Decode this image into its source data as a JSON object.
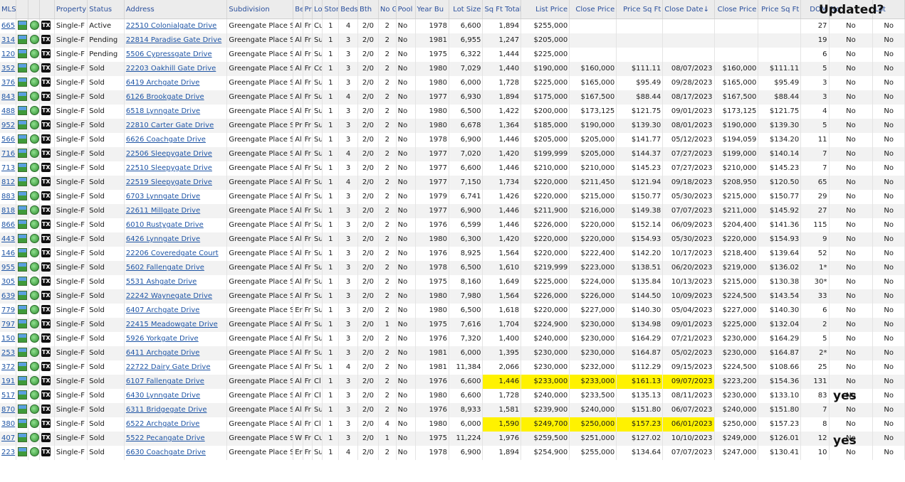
{
  "annotations": {
    "updated_label": "Updated?",
    "yes_label": "yes"
  },
  "columns": [
    "MLS",
    "Property",
    "Status",
    "Address",
    "Subdivision",
    "Be",
    "Pr",
    "Lo",
    "Stori",
    "Beds",
    "Bth",
    "No G",
    "Pool",
    "Year Bu",
    "Lot Size",
    "Sq Ft Total",
    "List Price",
    "Close Price",
    "Price Sq Ft",
    "Close Date",
    "Close Price",
    "Price Sq Ft",
    "DOM",
    "No",
    "Lot"
  ],
  "sort_arrow": "↓",
  "icons": [
    "photo-icon",
    "globe-icon",
    "tx-badge-icon"
  ],
  "tx_label": "TX",
  "rows": [
    {
      "mls": "665",
      "prop": "Single-F",
      "status": "Active",
      "addr": "22510 Colonialgate Drive",
      "subd": "Greengate Place S",
      "be": "Al",
      "pr": "Fr",
      "lo": "Cu",
      "st": "1",
      "beds": "4",
      "bth": "2/0",
      "gar": "2",
      "pool": "No",
      "yr": "1978",
      "lot": "6,600",
      "sqft": "1,894",
      "lp": "$255,000",
      "cp": "",
      "psf": "",
      "cd": "",
      "cp2": "",
      "psf2": "",
      "dom": "27",
      "n1": "No",
      "n2": "No"
    },
    {
      "mls": "314",
      "prop": "Single-F",
      "status": "Pending",
      "addr": "22814 Paradise Gate Drive",
      "subd": "Greengate Place S",
      "be": "Al",
      "pr": "Fr",
      "lo": "Su",
      "st": "1",
      "beds": "3",
      "bth": "2/0",
      "gar": "2",
      "pool": "No",
      "yr": "1981",
      "lot": "6,955",
      "sqft": "1,247",
      "lp": "$205,000",
      "cp": "",
      "psf": "",
      "cd": "",
      "cp2": "",
      "psf2": "",
      "dom": "19",
      "n1": "No",
      "n2": "No"
    },
    {
      "mls": "120",
      "prop": "Single-F",
      "status": "Pending",
      "addr": "5506 Cypressgate Drive",
      "subd": "Greengate Place S",
      "be": "Al",
      "pr": "Fr",
      "lo": "Su",
      "st": "1",
      "beds": "3",
      "bth": "2/0",
      "gar": "2",
      "pool": "No",
      "yr": "1975",
      "lot": "6,322",
      "sqft": "1,444",
      "lp": "$225,000",
      "cp": "",
      "psf": "",
      "cd": "",
      "cp2": "",
      "psf2": "",
      "dom": "6",
      "n1": "No",
      "n2": "No"
    },
    {
      "mls": "352",
      "prop": "Single-F",
      "status": "Sold",
      "addr": "22203 Oakhill Gate Drive",
      "subd": "Greengate Place S",
      "be": "Al",
      "pr": "Fr",
      "lo": "Co",
      "st": "1",
      "beds": "3",
      "bth": "2/0",
      "gar": "2",
      "pool": "No",
      "yr": "1980",
      "lot": "7,029",
      "sqft": "1,440",
      "lp": "$190,000",
      "cp": "$160,000",
      "psf": "$111.11",
      "cd": "08/07/2023",
      "cp2": "$160,000",
      "psf2": "$111.11",
      "dom": "5",
      "n1": "No",
      "n2": "No"
    },
    {
      "mls": "376",
      "prop": "Single-F",
      "status": "Sold",
      "addr": "6419 Archgate Drive",
      "subd": "Greengate Place S",
      "be": "Al",
      "pr": "Fr",
      "lo": "Su",
      "st": "1",
      "beds": "3",
      "bth": "2/0",
      "gar": "2",
      "pool": "No",
      "yr": "1980",
      "lot": "6,000",
      "sqft": "1,728",
      "lp": "$225,000",
      "cp": "$165,000",
      "psf": "$95.49",
      "cd": "09/28/2023",
      "cp2": "$165,000",
      "psf2": "$95.49",
      "dom": "3",
      "n1": "No",
      "n2": "No"
    },
    {
      "mls": "843",
      "prop": "Single-F",
      "status": "Sold",
      "addr": "6126 Brookgate Drive",
      "subd": "Greengate Place S",
      "be": "Al",
      "pr": "Fr",
      "lo": "Su",
      "st": "1",
      "beds": "4",
      "bth": "2/0",
      "gar": "2",
      "pool": "No",
      "yr": "1977",
      "lot": "6,930",
      "sqft": "1,894",
      "lp": "$175,000",
      "cp": "$167,500",
      "psf": "$88.44",
      "cd": "08/17/2023",
      "cp2": "$167,500",
      "psf2": "$88.44",
      "dom": "3",
      "n1": "No",
      "n2": "No"
    },
    {
      "mls": "488",
      "prop": "Single-F",
      "status": "Sold",
      "addr": "6518 Lynngate Drive",
      "subd": "Greengate Place S",
      "be": "Al",
      "pr": "Fr",
      "lo": "Su",
      "st": "1",
      "beds": "3",
      "bth": "2/0",
      "gar": "2",
      "pool": "No",
      "yr": "1980",
      "lot": "6,500",
      "sqft": "1,422",
      "lp": "$200,000",
      "cp": "$173,125",
      "psf": "$121.75",
      "cd": "09/01/2023",
      "cp2": "$173,125",
      "psf2": "$121.75",
      "dom": "4",
      "n1": "No",
      "n2": "No"
    },
    {
      "mls": "952",
      "prop": "Single-F",
      "status": "Sold",
      "addr": "22810 Carter Gate Drive",
      "subd": "Greengate Place S",
      "be": "Pr",
      "pr": "Fr",
      "lo": "Su",
      "st": "1",
      "beds": "3",
      "bth": "2/0",
      "gar": "2",
      "pool": "No",
      "yr": "1980",
      "lot": "6,678",
      "sqft": "1,364",
      "lp": "$185,000",
      "cp": "$190,000",
      "psf": "$139.30",
      "cd": "08/01/2023",
      "cp2": "$190,000",
      "psf2": "$139.30",
      "dom": "5",
      "n1": "No",
      "n2": "No"
    },
    {
      "mls": "566",
      "prop": "Single-F",
      "status": "Sold",
      "addr": "6626 Coachgate Drive",
      "subd": "Greengate Place S",
      "be": "Al",
      "pr": "Fr",
      "lo": "Su",
      "st": "1",
      "beds": "3",
      "bth": "2/0",
      "gar": "2",
      "pool": "No",
      "yr": "1978",
      "lot": "6,900",
      "sqft": "1,446",
      "lp": "$205,000",
      "cp": "$205,000",
      "psf": "$141.77",
      "cd": "05/12/2023",
      "cp2": "$194,059",
      "psf2": "$134.20",
      "dom": "11",
      "n1": "No",
      "n2": "No"
    },
    {
      "mls": "716",
      "prop": "Single-F",
      "status": "Sold",
      "addr": "22506 Sleepygate Drive",
      "subd": "Greengate Place S",
      "be": "Al",
      "pr": "Fr",
      "lo": "Su",
      "st": "1",
      "beds": "4",
      "bth": "2/0",
      "gar": "2",
      "pool": "No",
      "yr": "1977",
      "lot": "7,020",
      "sqft": "1,420",
      "lp": "$199,999",
      "cp": "$205,000",
      "psf": "$144.37",
      "cd": "07/27/2023",
      "cp2": "$199,000",
      "psf2": "$140.14",
      "dom": "7",
      "n1": "No",
      "n2": "No"
    },
    {
      "mls": "713",
      "prop": "Single-F",
      "status": "Sold",
      "addr": "22510 Sleepygate Drive",
      "subd": "Greengate Place S",
      "be": "Al",
      "pr": "Fr",
      "lo": "Su",
      "st": "1",
      "beds": "3",
      "bth": "2/0",
      "gar": "2",
      "pool": "No",
      "yr": "1977",
      "lot": "6,600",
      "sqft": "1,446",
      "lp": "$210,000",
      "cp": "$210,000",
      "psf": "$145.23",
      "cd": "07/27/2023",
      "cp2": "$210,000",
      "psf2": "$145.23",
      "dom": "7",
      "n1": "No",
      "n2": "No"
    },
    {
      "mls": "812",
      "prop": "Single-F",
      "status": "Sold",
      "addr": "22519 Sleepygate Drive",
      "subd": "Greengate Place S",
      "be": "Al",
      "pr": "Fr",
      "lo": "Su",
      "st": "1",
      "beds": "4",
      "bth": "2/0",
      "gar": "2",
      "pool": "No",
      "yr": "1977",
      "lot": "7,150",
      "sqft": "1,734",
      "lp": "$220,000",
      "cp": "$211,450",
      "psf": "$121.94",
      "cd": "09/18/2023",
      "cp2": "$208,950",
      "psf2": "$120.50",
      "dom": "65",
      "n1": "No",
      "n2": "No"
    },
    {
      "mls": "883",
      "prop": "Single-F",
      "status": "Sold",
      "addr": "6703 Lynngate Drive",
      "subd": "Greengate Place S",
      "be": "Al",
      "pr": "Fr",
      "lo": "Su",
      "st": "1",
      "beds": "3",
      "bth": "2/0",
      "gar": "2",
      "pool": "No",
      "yr": "1979",
      "lot": "6,741",
      "sqft": "1,426",
      "lp": "$220,000",
      "cp": "$215,000",
      "psf": "$150.77",
      "cd": "05/30/2023",
      "cp2": "$215,000",
      "psf2": "$150.77",
      "dom": "29",
      "n1": "No",
      "n2": "No"
    },
    {
      "mls": "818",
      "prop": "Single-F",
      "status": "Sold",
      "addr": "22611 Millgate Drive",
      "subd": "Greengate Place S",
      "be": "Al",
      "pr": "Fr",
      "lo": "Su",
      "st": "1",
      "beds": "3",
      "bth": "2/0",
      "gar": "2",
      "pool": "No",
      "yr": "1977",
      "lot": "6,900",
      "sqft": "1,446",
      "lp": "$211,900",
      "cp": "$216,000",
      "psf": "$149.38",
      "cd": "07/07/2023",
      "cp2": "$211,000",
      "psf2": "$145.92",
      "dom": "27",
      "n1": "No",
      "n2": "No"
    },
    {
      "mls": "866",
      "prop": "Single-F",
      "status": "Sold",
      "addr": "6010 Rustygate Drive",
      "subd": "Greengate Place S",
      "be": "Al",
      "pr": "Fr",
      "lo": "Su",
      "st": "1",
      "beds": "3",
      "bth": "2/0",
      "gar": "2",
      "pool": "No",
      "yr": "1976",
      "lot": "6,599",
      "sqft": "1,446",
      "lp": "$226,000",
      "cp": "$220,000",
      "psf": "$152.14",
      "cd": "06/09/2023",
      "cp2": "$204,400",
      "psf2": "$141.36",
      "dom": "115",
      "n1": "No",
      "n2": "No"
    },
    {
      "mls": "443",
      "prop": "Single-F",
      "status": "Sold",
      "addr": "6426 Lynngate Drive",
      "subd": "Greengate Place S",
      "be": "Al",
      "pr": "Fr",
      "lo": "Su",
      "st": "1",
      "beds": "3",
      "bth": "2/0",
      "gar": "2",
      "pool": "No",
      "yr": "1980",
      "lot": "6,300",
      "sqft": "1,420",
      "lp": "$220,000",
      "cp": "$220,000",
      "psf": "$154.93",
      "cd": "05/30/2023",
      "cp2": "$220,000",
      "psf2": "$154.93",
      "dom": "9",
      "n1": "No",
      "n2": "No"
    },
    {
      "mls": "146",
      "prop": "Single-F",
      "status": "Sold",
      "addr": "22206 Coveredgate Court",
      "subd": "Greengate Place S",
      "be": "Al",
      "pr": "Fr",
      "lo": "Su",
      "st": "1",
      "beds": "3",
      "bth": "2/0",
      "gar": "2",
      "pool": "No",
      "yr": "1976",
      "lot": "8,925",
      "sqft": "1,564",
      "lp": "$220,000",
      "cp": "$222,400",
      "psf": "$142.20",
      "cd": "10/17/2023",
      "cp2": "$218,400",
      "psf2": "$139.64",
      "dom": "52",
      "n1": "No",
      "n2": "No"
    },
    {
      "mls": "955",
      "prop": "Single-F",
      "status": "Sold",
      "addr": "5602 Fallengate Drive",
      "subd": "Greengate Place S",
      "be": "Al",
      "pr": "Fr",
      "lo": "Su",
      "st": "1",
      "beds": "3",
      "bth": "2/0",
      "gar": "2",
      "pool": "No",
      "yr": "1978",
      "lot": "6,500",
      "sqft": "1,610",
      "lp": "$219,999",
      "cp": "$223,000",
      "psf": "$138.51",
      "cd": "06/20/2023",
      "cp2": "$219,000",
      "psf2": "$136.02",
      "dom": "1*",
      "n1": "No",
      "n2": "No"
    },
    {
      "mls": "305",
      "prop": "Single-F",
      "status": "Sold",
      "addr": "5531 Ashgate Drive",
      "subd": "Greengate Place S",
      "be": "Al",
      "pr": "Fr",
      "lo": "Su",
      "st": "1",
      "beds": "3",
      "bth": "2/0",
      "gar": "2",
      "pool": "No",
      "yr": "1975",
      "lot": "8,160",
      "sqft": "1,649",
      "lp": "$225,000",
      "cp": "$224,000",
      "psf": "$135.84",
      "cd": "10/13/2023",
      "cp2": "$215,000",
      "psf2": "$130.38",
      "dom": "30*",
      "n1": "No",
      "n2": "No"
    },
    {
      "mls": "639",
      "prop": "Single-F",
      "status": "Sold",
      "addr": "22242 Waynegate Drive",
      "subd": "Greengate Place S",
      "be": "Al",
      "pr": "Fr",
      "lo": "Su",
      "st": "1",
      "beds": "3",
      "bth": "2/0",
      "gar": "2",
      "pool": "No",
      "yr": "1980",
      "lot": "7,980",
      "sqft": "1,564",
      "lp": "$226,000",
      "cp": "$226,000",
      "psf": "$144.50",
      "cd": "10/09/2023",
      "cp2": "$224,500",
      "psf2": "$143.54",
      "dom": "33",
      "n1": "No",
      "n2": "No"
    },
    {
      "mls": "779",
      "prop": "Single-F",
      "status": "Sold",
      "addr": "6407 Archgate Drive",
      "subd": "Greengate Place S",
      "be": "Er",
      "pr": "Fr",
      "lo": "Su",
      "st": "1",
      "beds": "3",
      "bth": "2/0",
      "gar": "2",
      "pool": "No",
      "yr": "1980",
      "lot": "6,500",
      "sqft": "1,618",
      "lp": "$220,000",
      "cp": "$227,000",
      "psf": "$140.30",
      "cd": "05/04/2023",
      "cp2": "$227,000",
      "psf2": "$140.30",
      "dom": "6",
      "n1": "No",
      "n2": "No"
    },
    {
      "mls": "797",
      "prop": "Single-F",
      "status": "Sold",
      "addr": "22415 Meadowgate Drive",
      "subd": "Greengate Place S",
      "be": "Al",
      "pr": "Fr",
      "lo": "Su",
      "st": "1",
      "beds": "3",
      "bth": "2/0",
      "gar": "1",
      "pool": "No",
      "yr": "1975",
      "lot": "7,616",
      "sqft": "1,704",
      "lp": "$224,900",
      "cp": "$230,000",
      "psf": "$134.98",
      "cd": "09/01/2023",
      "cp2": "$225,000",
      "psf2": "$132.04",
      "dom": "2",
      "n1": "No",
      "n2": "No"
    },
    {
      "mls": "150",
      "prop": "Single-F",
      "status": "Sold",
      "addr": "5926 Yorkgate Drive",
      "subd": "Greengate Place S",
      "be": "Al",
      "pr": "Fr",
      "lo": "Su",
      "st": "1",
      "beds": "3",
      "bth": "2/0",
      "gar": "2",
      "pool": "No",
      "yr": "1976",
      "lot": "7,320",
      "sqft": "1,400",
      "lp": "$240,000",
      "cp": "$230,000",
      "psf": "$164.29",
      "cd": "07/21/2023",
      "cp2": "$230,000",
      "psf2": "$164.29",
      "dom": "5",
      "n1": "No",
      "n2": "No"
    },
    {
      "mls": "253",
      "prop": "Single-F",
      "status": "Sold",
      "addr": "6411 Archgate Drive",
      "subd": "Greengate Place S",
      "be": "Al",
      "pr": "Fr",
      "lo": "Su",
      "st": "1",
      "beds": "3",
      "bth": "2/0",
      "gar": "2",
      "pool": "No",
      "yr": "1981",
      "lot": "6,000",
      "sqft": "1,395",
      "lp": "$230,000",
      "cp": "$230,000",
      "psf": "$164.87",
      "cd": "05/02/2023",
      "cp2": "$230,000",
      "psf2": "$164.87",
      "dom": "2*",
      "n1": "No",
      "n2": "No"
    },
    {
      "mls": "372",
      "prop": "Single-F",
      "status": "Sold",
      "addr": "22722 Dairy Gate Drive",
      "subd": "Greengate Place S",
      "be": "Al",
      "pr": "Fr",
      "lo": "Su",
      "st": "1",
      "beds": "4",
      "bth": "2/0",
      "gar": "2",
      "pool": "No",
      "yr": "1981",
      "lot": "11,384",
      "sqft": "2,066",
      "lp": "$230,000",
      "cp": "$232,000",
      "psf": "$112.29",
      "cd": "09/15/2023",
      "cp2": "$224,500",
      "psf2": "$108.66",
      "dom": "25",
      "n1": "No",
      "n2": "No"
    },
    {
      "mls": "191",
      "prop": "Single-F",
      "status": "Sold",
      "addr": "6107 Fallengate Drive",
      "subd": "Greengate Place S",
      "be": "Al",
      "pr": "Fr",
      "lo": "Cl",
      "st": "1",
      "beds": "3",
      "bth": "2/0",
      "gar": "2",
      "pool": "No",
      "yr": "1976",
      "lot": "6,600",
      "sqft": "1,446",
      "lp": "$233,000",
      "cp": "$233,000",
      "psf": "$161.13",
      "cd": "09/07/2023",
      "cp2": "$223,200",
      "psf2": "$154.36",
      "dom": "131",
      "n1": "No",
      "n2": "No",
      "hl": true
    },
    {
      "mls": "517",
      "prop": "Single-F",
      "status": "Sold",
      "addr": "6430 Lynngate Drive",
      "subd": "Greengate Place S",
      "be": "Al",
      "pr": "Fr",
      "lo": "Cl",
      "st": "1",
      "beds": "3",
      "bth": "2/0",
      "gar": "2",
      "pool": "No",
      "yr": "1980",
      "lot": "6,600",
      "sqft": "1,728",
      "lp": "$240,000",
      "cp": "$233,500",
      "psf": "$135.13",
      "cd": "08/11/2023",
      "cp2": "$230,000",
      "psf2": "$133.10",
      "dom": "83",
      "n1": "No",
      "n2": "No"
    },
    {
      "mls": "870",
      "prop": "Single-F",
      "status": "Sold",
      "addr": "6311 Bridgegate Drive",
      "subd": "Greengate Place S",
      "be": "Al",
      "pr": "Fr",
      "lo": "Su",
      "st": "1",
      "beds": "3",
      "bth": "2/0",
      "gar": "2",
      "pool": "No",
      "yr": "1976",
      "lot": "8,933",
      "sqft": "1,581",
      "lp": "$239,900",
      "cp": "$240,000",
      "psf": "$151.80",
      "cd": "06/07/2023",
      "cp2": "$240,000",
      "psf2": "$151.80",
      "dom": "7",
      "n1": "No",
      "n2": "No"
    },
    {
      "mls": "380",
      "prop": "Single-F",
      "status": "Sold",
      "addr": "6522 Archgate Drive",
      "subd": "Greengate Place S",
      "be": "Al",
      "pr": "Fr",
      "lo": "Cl",
      "st": "1",
      "beds": "3",
      "bth": "2/0",
      "gar": "4",
      "pool": "No",
      "yr": "1980",
      "lot": "6,000",
      "sqft": "1,590",
      "lp": "$249,700",
      "cp": "$250,000",
      "psf": "$157.23",
      "cd": "06/01/2023",
      "cp2": "$250,000",
      "psf2": "$157.23",
      "dom": "8",
      "n1": "No",
      "n2": "No",
      "hl": true
    },
    {
      "mls": "407",
      "prop": "Single-F",
      "status": "Sold",
      "addr": "5522 Pecangate Drive",
      "subd": "Greengate Place S",
      "be": "W",
      "pr": "Fr",
      "lo": "Cu",
      "st": "1",
      "beds": "3",
      "bth": "2/0",
      "gar": "1",
      "pool": "No",
      "yr": "1975",
      "lot": "11,224",
      "sqft": "1,976",
      "lp": "$259,500",
      "cp": "$251,000",
      "psf": "$127.02",
      "cd": "10/10/2023",
      "cp2": "$249,000",
      "psf2": "$126.01",
      "dom": "12",
      "n1": "No",
      "n2": "No"
    },
    {
      "mls": "223",
      "prop": "Single-F",
      "status": "Sold",
      "addr": "6630 Coachgate Drive",
      "subd": "Greengate Place S",
      "be": "Er",
      "pr": "Fr",
      "lo": "Su",
      "st": "1",
      "beds": "4",
      "bth": "2/0",
      "gar": "2",
      "pool": "No",
      "yr": "1978",
      "lot": "6,900",
      "sqft": "1,894",
      "lp": "$254,900",
      "cp": "$255,000",
      "psf": "$134.64",
      "cd": "07/07/2023",
      "cp2": "$247,000",
      "psf2": "$130.41",
      "dom": "10",
      "n1": "No",
      "n2": "No"
    }
  ]
}
